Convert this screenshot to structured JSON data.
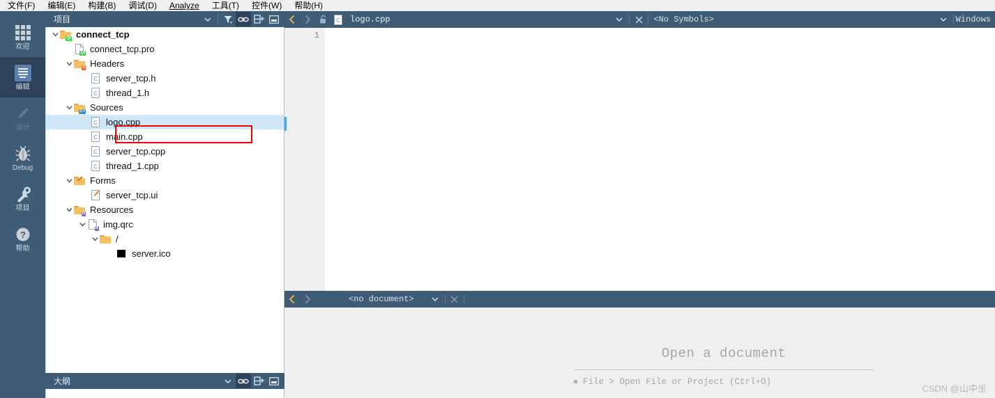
{
  "menubar": {
    "items": [
      {
        "label": "文件(F)",
        "mnemonic": "F"
      },
      {
        "label": "编辑(E)",
        "mnemonic": "E"
      },
      {
        "label": "构建(B)",
        "mnemonic": "B"
      },
      {
        "label": "调试(D)",
        "mnemonic": "D"
      },
      {
        "label": "Analyze",
        "mnemonic": "A"
      },
      {
        "label": "工具(T)",
        "mnemonic": "T"
      },
      {
        "label": "控件(W)",
        "mnemonic": "W"
      },
      {
        "label": "帮助(H)",
        "mnemonic": "H"
      }
    ]
  },
  "modebar": {
    "items": [
      {
        "label": "欢迎",
        "icon": "grid-icon",
        "active": false,
        "enabled": true
      },
      {
        "label": "编辑",
        "icon": "edit-lines-icon",
        "active": true,
        "enabled": true
      },
      {
        "label": "设计",
        "icon": "pencil-icon",
        "active": false,
        "enabled": false
      },
      {
        "label": "Debug",
        "icon": "bug-icon",
        "active": false,
        "enabled": true
      },
      {
        "label": "项目",
        "icon": "wrench-icon",
        "active": false,
        "enabled": true
      },
      {
        "label": "帮助",
        "icon": "question-mark-icon",
        "active": false,
        "enabled": true
      }
    ]
  },
  "project_panel": {
    "title": "项目",
    "toolbar": [
      {
        "name": "combo-dropdown",
        "icon": "chevron-down-icon"
      },
      {
        "name": "filter",
        "icon": "filter-icon"
      },
      {
        "name": "synchronize-with-editor",
        "icon": "link-icon",
        "active": true
      },
      {
        "name": "split-add",
        "icon": "split-add-icon"
      },
      {
        "name": "close-panel",
        "icon": "minimize-icon"
      }
    ],
    "tree": [
      {
        "label": "connect_tcp",
        "depth": 0,
        "icon": "qt-project-folder-icon",
        "expandable": true,
        "expanded": true,
        "bold": true,
        "selected": false
      },
      {
        "label": "connect_tcp.pro",
        "depth": 1,
        "icon": "qt-pro-file-icon",
        "expandable": false,
        "expanded": false,
        "bold": false,
        "selected": false
      },
      {
        "label": "Headers",
        "depth": 1,
        "icon": "headers-folder-icon",
        "expandable": true,
        "expanded": true,
        "bold": false,
        "selected": false
      },
      {
        "label": "server_tcp.h",
        "depth": 2,
        "icon": "c-header-file-icon",
        "expandable": false,
        "expanded": false,
        "bold": false,
        "selected": false
      },
      {
        "label": "thread_1.h",
        "depth": 2,
        "icon": "c-header-file-icon",
        "expandable": false,
        "expanded": false,
        "bold": false,
        "selected": false
      },
      {
        "label": "Sources",
        "depth": 1,
        "icon": "sources-folder-icon",
        "expandable": true,
        "expanded": true,
        "bold": false,
        "selected": false
      },
      {
        "label": "logo.cpp",
        "depth": 2,
        "icon": "cpp-source-file-icon",
        "expandable": false,
        "expanded": false,
        "bold": false,
        "selected": true
      },
      {
        "label": "main.cpp",
        "depth": 2,
        "icon": "cpp-source-file-icon",
        "expandable": false,
        "expanded": false,
        "bold": false,
        "selected": false
      },
      {
        "label": "server_tcp.cpp",
        "depth": 2,
        "icon": "cpp-source-file-icon",
        "expandable": false,
        "expanded": false,
        "bold": false,
        "selected": false
      },
      {
        "label": "thread_1.cpp",
        "depth": 2,
        "icon": "cpp-source-file-icon",
        "expandable": false,
        "expanded": false,
        "bold": false,
        "selected": false
      },
      {
        "label": "Forms",
        "depth": 1,
        "icon": "forms-folder-icon",
        "expandable": true,
        "expanded": true,
        "bold": false,
        "selected": false
      },
      {
        "label": "server_tcp.ui",
        "depth": 2,
        "icon": "ui-form-file-icon",
        "expandable": false,
        "expanded": false,
        "bold": false,
        "selected": false
      },
      {
        "label": "Resources",
        "depth": 1,
        "icon": "resources-folder-icon",
        "expandable": true,
        "expanded": true,
        "bold": false,
        "selected": false
      },
      {
        "label": "img.qrc",
        "depth": 2,
        "icon": "qrc-file-icon",
        "expandable": true,
        "expanded": true,
        "bold": false,
        "selected": false
      },
      {
        "label": "/",
        "depth": 3,
        "icon": "plain-folder-icon",
        "expandable": true,
        "expanded": true,
        "bold": false,
        "selected": false
      },
      {
        "label": "server.ico",
        "depth": 4,
        "icon": "ico-image-icon",
        "expandable": false,
        "expanded": false,
        "bold": false,
        "selected": false
      }
    ]
  },
  "outline_panel": {
    "title": "大纲",
    "toolbar": [
      {
        "name": "combo-dropdown",
        "icon": "chevron-down-icon"
      },
      {
        "name": "synchronize-with-editor",
        "icon": "link-icon",
        "active": true
      },
      {
        "name": "split-add",
        "icon": "split-add-icon"
      },
      {
        "name": "close-panel",
        "icon": "minimize-icon"
      }
    ]
  },
  "editor_top": {
    "filename": "logo.cpp",
    "file_icon": "cpp-source-file-icon",
    "lock_icon": "unlocked-icon",
    "symbols_label": "<No Symbols>",
    "right_label": "Windows",
    "nav_back": "chevron-left-icon",
    "nav_forward": "chevron-right-icon",
    "dropdown_icon": "chevron-down-icon",
    "close_icon": "close-x-icon",
    "line_number": "1"
  },
  "editor_bottom": {
    "document_label": "<no document>",
    "nav_back": "chevron-left-icon",
    "nav_forward": "chevron-right-icon",
    "dropdown_icon": "chevron-down-icon",
    "close_icon": "close-x-icon",
    "placeholder_title": "Open a document",
    "placeholder_items": [
      "File > Open File or Project (Ctrl+O)"
    ]
  },
  "watermark": "CSDN @山中坐",
  "colors": {
    "chrome": "#3f5c77",
    "chrome_active": "#2e4259",
    "selection": "#cfe8f9",
    "annotation": "#f40000",
    "gutter": "#efefef",
    "menubar": "#f0f0f0"
  }
}
